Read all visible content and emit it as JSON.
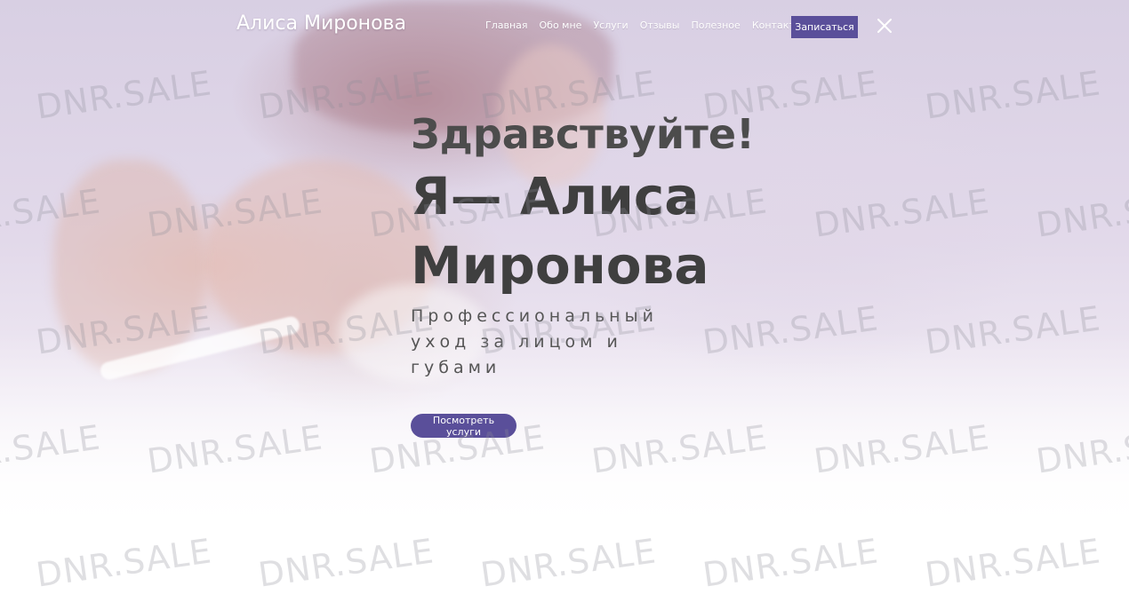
{
  "header": {
    "logo": "Алиса Миронова",
    "nav": [
      {
        "label": "Главная"
      },
      {
        "label": "Обо мне"
      },
      {
        "label": "Услуги"
      },
      {
        "label": "Отзывы"
      },
      {
        "label": "Полезное"
      },
      {
        "label": "Контакты"
      }
    ],
    "signup_label": "Записаться",
    "close_icon": "close-icon"
  },
  "hero": {
    "greeting": "Здравствуйте!",
    "name": "Я— Алиса Миронова",
    "tagline": "Профессиональный уход за лицом и губами",
    "cta_label": "Посмотреть услуги"
  },
  "watermark": {
    "text": "DNR.SALE"
  },
  "colors": {
    "accent": "#5a4f9a",
    "heading": "#3f3f3f",
    "nav_text": "#ffffff"
  }
}
